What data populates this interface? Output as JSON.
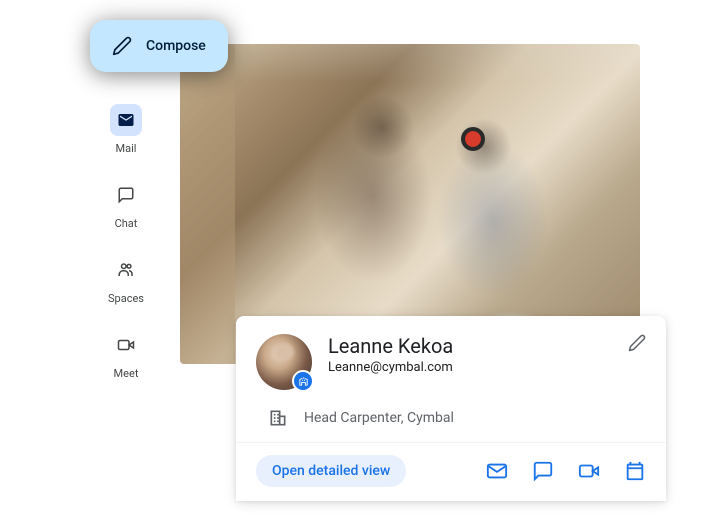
{
  "compose": {
    "label": "Compose"
  },
  "nav": {
    "mail": "Mail",
    "chat": "Chat",
    "spaces": "Spaces",
    "meet": "Meet"
  },
  "contact": {
    "name": "Leanne Kekoa",
    "email": "Leanne@cymbal.com",
    "role": "Head Carpenter, Cymbal",
    "detailed_view": "Open detailed view"
  },
  "colors": {
    "accent": "#1a73e8",
    "compose_bg": "#c2e7ff"
  }
}
